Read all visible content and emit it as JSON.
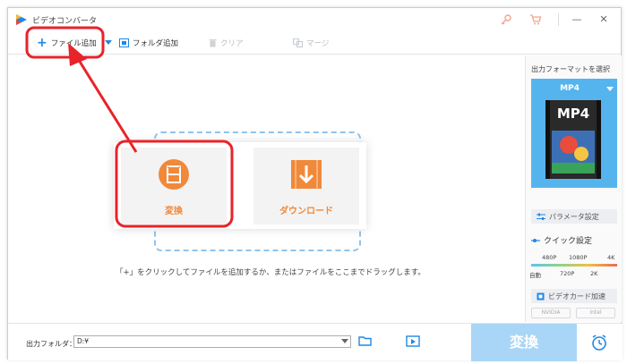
{
  "window": {
    "title": "ビデオコンバータ"
  },
  "toolbar": {
    "add_file": "ファイル追加",
    "add_folder": "フォルダ追加",
    "clear": "クリア",
    "merge": "マージ"
  },
  "main": {
    "cards": [
      {
        "label": "変換",
        "icon": "film-icon"
      },
      {
        "label": "ダウンロード",
        "icon": "download-icon"
      }
    ],
    "hint": "「+」をクリックしてファイルを追加するか、またはファイルをここまでドラッグします。"
  },
  "right_panel": {
    "title": "出力フォーマットを選択",
    "format": "MP4",
    "thumb_label": "MP4",
    "param_label": "パラメータ設定",
    "quick_label": "クイック設定",
    "quality_top": [
      "480P",
      "1080P",
      "4K"
    ],
    "quality_bottom": [
      "自動",
      "720P",
      "2K"
    ],
    "gpu_label": "ビデオカード加速",
    "gpu_chips": [
      "NVIDIA",
      "Intel"
    ]
  },
  "bottom": {
    "output_label": "出力フォルダ：",
    "output_value": "D:¥",
    "convert_label": "変換"
  },
  "colors": {
    "accent": "#1e88e5",
    "orange": "#f0893a",
    "format_bg": "#55b4ee",
    "annotation_red": "#e8232a"
  }
}
